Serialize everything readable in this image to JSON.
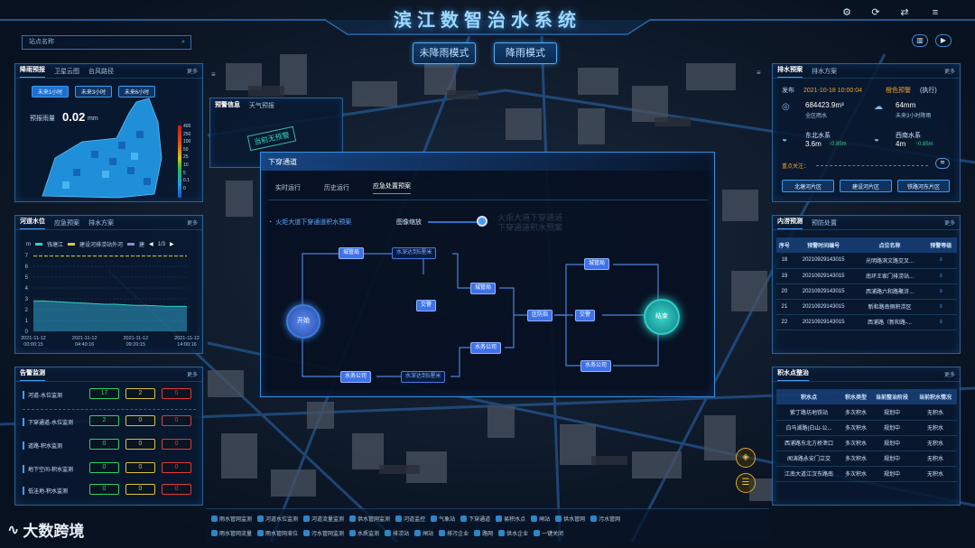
{
  "app": {
    "title": "滨江数智治水系统",
    "modes": [
      "未降雨模式",
      "降雨模式"
    ]
  },
  "search": {
    "placeholder": "站点名称"
  },
  "rain_panel": {
    "tabs": [
      "降雨预报",
      "卫星云图",
      "台风路径"
    ],
    "more": "更多",
    "buttons": [
      "未来1小时",
      "未来3小时",
      "未来6小时"
    ],
    "label": "预报雨量",
    "value": "0.02",
    "unit": "mm",
    "scale": [
      "400",
      "250",
      "100",
      "50",
      "25",
      "10",
      "5",
      "0.1",
      "0"
    ]
  },
  "warn_panel": {
    "tabs": [
      "预警信息",
      "天气预报"
    ],
    "stamp": "当前无预警"
  },
  "river_panel": {
    "tabs": [
      "河道水位",
      "应急预案",
      "排水方案"
    ],
    "more": "更多",
    "unit": "m",
    "legend": [
      "钱塘江",
      "建设河排涝站外河",
      "建"
    ],
    "page": "1/3",
    "chart_data": {
      "type": "area",
      "yticks": [
        "7",
        "6",
        "5",
        "4",
        "3",
        "2",
        "1",
        "0"
      ],
      "ylim": [
        0,
        7
      ],
      "xlabels": [
        "2021-11-12 00:00:15",
        "2021-11-12 04:40:16",
        "2021-11-12 09:20:15",
        "2021-11-12 14:00:16"
      ],
      "series": [
        {
          "name": "钱塘江",
          "values": [
            2.8,
            2.8,
            2.75,
            2.7,
            2.65,
            2.6,
            2.55,
            2.5,
            2.5,
            2.45,
            2.4,
            2.4,
            2.35,
            2.3,
            2.3,
            2.3
          ]
        },
        {
          "name": "建设河排涝站外河",
          "values": [
            6.95,
            6.95,
            6.95,
            6.95,
            6.95,
            6.95,
            6.95,
            6.95,
            6.95,
            6.95,
            6.95,
            6.95,
            6.95,
            6.95,
            6.95,
            6.95
          ]
        }
      ]
    }
  },
  "alarm_panel": {
    "title": "告警监测",
    "more": "更多",
    "rows": [
      {
        "label": "河道-水位监测",
        "v": [
          "17",
          "2",
          "0"
        ]
      },
      {
        "label": "下穿通道-水位监测",
        "v": [
          "2",
          "0",
          "0"
        ]
      },
      {
        "label": "道路-积水监测",
        "v": [
          "0",
          "0",
          "0"
        ]
      },
      {
        "label": "地下空间-积水监测",
        "v": [
          "0",
          "0",
          "0"
        ]
      },
      {
        "label": "低洼地-积水监测",
        "v": [
          "0",
          "0",
          "0"
        ]
      }
    ]
  },
  "underpass": {
    "title": "下穿通道",
    "tabs": [
      "实时运行",
      "历史运行",
      "应急处置预案"
    ],
    "plan": "火炬大道下穿通道积水预案",
    "zoom": "图像缩放",
    "watermark": [
      "火炬大道下穿通道",
      "下穿通道积水预案"
    ],
    "nodes": {
      "start": "开始",
      "end": "结束",
      "a": "城管局",
      "b": "水深达到5厘米",
      "c": "交警",
      "d": "城管局",
      "e": "水务公司",
      "f": "水深达到5厘米",
      "g": "水务公司",
      "h": "区防指",
      "i": "交警",
      "j": "城管局",
      "k": "水务公司"
    }
  },
  "drain_panel": {
    "tabs": [
      "排水预案",
      "排水方案"
    ],
    "more": "更多",
    "issued_label": "发布",
    "date": "2021-10-18 10:00:04",
    "level": "橙色预警",
    "status": "(执行)",
    "stats": [
      {
        "v": "684423.9m³",
        "l": "全区雨水"
      },
      {
        "v": "64mm",
        "l": "未来3小时降雨"
      },
      {
        "t": "东北水系",
        "v": "3.6m",
        "d": "0.85m"
      },
      {
        "t": "西南水系",
        "v": "4m",
        "d": "0.85m"
      }
    ],
    "focus": "重点关注：",
    "areas": [
      "北塘河片区",
      "建设河片区",
      "铁路河东片区"
    ]
  },
  "flood_panel": {
    "tabs": [
      "内涝预测",
      "预防处置"
    ],
    "more": "更多",
    "headers": [
      "序号",
      "预警时间编号",
      "点位名称",
      "预警等级"
    ],
    "rows": [
      {
        "n": "18",
        "id": "20210929143015",
        "name": "光明路滨文路交叉..."
      },
      {
        "n": "19",
        "id": "20210929143015",
        "name": "南环王家门排涝站..."
      },
      {
        "n": "20",
        "id": "20210929143015",
        "name": "西浦路六和路聚浒..."
      },
      {
        "n": "21",
        "id": "20210929143015",
        "name": "新和路南侧积涝区"
      },
      {
        "n": "22",
        "id": "20210929143015",
        "name": "西浦路（新和路-..."
      }
    ]
  },
  "water_panel": {
    "title": "积水点整治",
    "more": "更多",
    "headers": [
      "积水点",
      "积水类型",
      "当前整治阶段",
      "当前积水情况"
    ],
    "rows": [
      [
        "紫丁路坊地铁站",
        "多次积水",
        "规划中",
        "无积水"
      ],
      [
        "白马湖路(白山-公...",
        "多次积水",
        "规划中",
        "无积水"
      ],
      [
        "西浦路东北方桥泄口",
        "多次积水",
        "规划中",
        "无积水"
      ],
      [
        "闻涛路永安门立交",
        "多次积水",
        "规划中",
        "无积水"
      ],
      [
        "江南大道江汉东路南",
        "多次积水",
        "规划中",
        "无积水"
      ]
    ]
  },
  "legend": {
    "row1": [
      "雨水管网监测",
      "河道水位监测",
      "河道流量监测",
      "供水管网监测",
      "河道监控",
      "气象站",
      "下穿通道",
      "易积水点",
      "闸站",
      "供水管网",
      "污水管网"
    ],
    "row2": [
      "雨水管网流量",
      "雨水管网液位",
      "污水管网监测",
      "水质监测",
      "排涝站",
      "闸站",
      "排污企业",
      "路网",
      "供水企业",
      "一键关闭"
    ]
  },
  "brand": {
    "name": "大数跨境"
  }
}
